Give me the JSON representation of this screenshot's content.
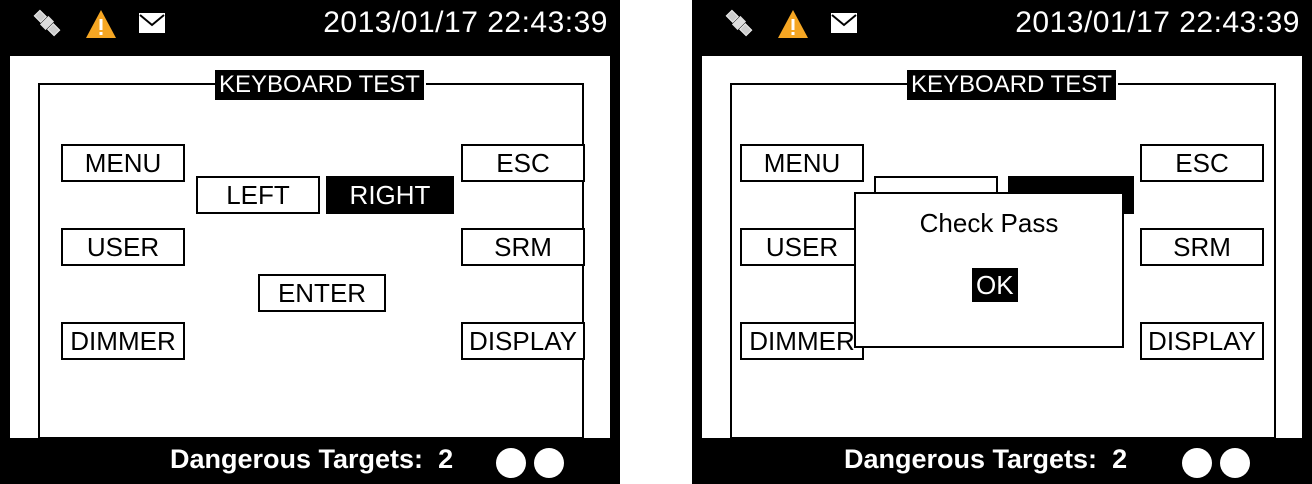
{
  "status": {
    "datetime": "2013/01/17 22:43:39",
    "icons": [
      "satellite-icon",
      "warning-icon",
      "mail-icon"
    ],
    "warning_color": "#f5a623"
  },
  "title": "KEYBOARD TEST",
  "keys": {
    "menu": "MENU",
    "esc": "ESC",
    "left": "LEFT",
    "right": "RIGHT",
    "user": "USER",
    "srm": "SRM",
    "enter": "ENTER",
    "dimmer": "DIMMER",
    "display": "DISPLAY"
  },
  "dialog": {
    "message": "Check Pass",
    "ok_label": "OK"
  },
  "footer": {
    "label": "Dangerous Targets:",
    "count": "2",
    "indicators": 2
  }
}
